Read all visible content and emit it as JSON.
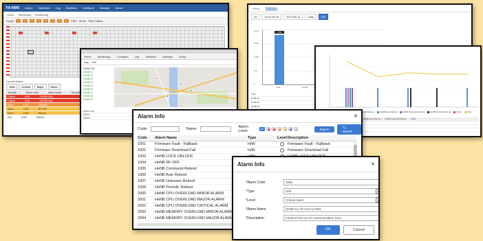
{
  "nms_window": {
    "logo": "FA-NMS",
    "menu": [
      "Admin",
      "Operation",
      "Log",
      "Statistics",
      "Configure",
      "Manage",
      "About"
    ],
    "breadcrumb": [
      "Home",
      "Monitoring",
      "Monitoring"
    ],
    "toolbar": [
      "Single",
      "Filter",
      "Mode",
      "Filter Status"
    ],
    "alarm_title": "Current Alarm",
    "alarm_tabs": [
      "Total",
      "Critical",
      "Major",
      "Minor"
    ],
    "alarm_header": [
      "Severity",
      "Alarm Code",
      "Alarm Name",
      "Occurred",
      "Occur Time"
    ],
    "alarm_rows": [
      {
        "severity": "Critical",
        "code": "2001",
        "name": "OVERLOAD",
        "level": "red"
      },
      {
        "severity": "Critical",
        "code": "2002",
        "name": "OVERLOAD",
        "level": "red"
      },
      {
        "severity": "Major",
        "code": "1001",
        "name": "Fallback",
        "level": "orange"
      },
      {
        "severity": "Minor",
        "code": "1004",
        "name": "RF OFF",
        "level": "yellow"
      },
      {
        "severity": "Minor",
        "code": "1005",
        "name": "Reboot",
        "level": "yellow"
      },
      {
        "severity": "Info",
        "code": "1006",
        "name": "Reboot",
        "level": "white"
      }
    ]
  },
  "map_window": {
    "nav": [
      "Home",
      "Monitoring",
      "Configure",
      "Log",
      "Statistics",
      "Manage",
      "Setup"
    ],
    "toolbar": [
      "Map",
      "Tree"
    ],
    "tree_items": [
      "HeNB-GW",
      "HeNB 01",
      "HeNB 02",
      "HeNB 03",
      "HeNB 04",
      "HeNB 05",
      "HeNB 06",
      "HeNB 07",
      "HeNB 08",
      "HeNB 09"
    ],
    "bottom_rows": [
      "Alarm List",
      "Event",
      "Status"
    ]
  },
  "stats_window": {
    "tabs": [
      "Home",
      "Statistics"
    ],
    "filters": [
      "All",
      "2013-08-08",
      "2013-08-15",
      "Daily"
    ],
    "ok_label": "OK",
    "bar_label": "1,750",
    "y_ticks": [
      "2000",
      "1500",
      "1000",
      "500",
      "0"
    ],
    "x_labels": [
      "Total",
      "HeNB"
    ],
    "table_rows": [
      "Total",
      "HeNB 01",
      "HeNB 02",
      "HeNB 03",
      "HeNB 04"
    ]
  },
  "line_window": {
    "legend": [
      {
        "name": "HeNB RF OFF",
        "color": "#5b8fd9"
      },
      {
        "name": "HeNB Command Reboot",
        "color": "#e06ab0"
      },
      {
        "name": "HeNB Auto Reboot",
        "color": "#3aa0a0"
      },
      {
        "name": "HeNB Unknown Reboot",
        "color": "#8a5ab8"
      },
      {
        "name": "HeNB Periodic Reboot",
        "color": "#333333"
      },
      {
        "name": "Other",
        "color": "#d84a3a"
      },
      {
        "name": "Total",
        "color": "#f0c040"
      }
    ],
    "table_header": [
      "HeNB RF OFF",
      "HeNB Command Reboot",
      "HeNB Auto Reboot",
      "HeNB Unknown Reboot",
      "Other"
    ]
  },
  "alarm_list": {
    "title": "Alarm Info",
    "code_label": "Code:",
    "name_label": "Name:",
    "level_label": "Alarm Level",
    "level_all": "All",
    "export_label": "Export",
    "search_label": "Search",
    "columns": [
      "Code",
      "Alarm Name",
      "Type",
      "Level",
      "Description"
    ],
    "rows": [
      {
        "code": "1001",
        "name": "Firmware Fault - Fallback",
        "type": "H/W",
        "desc": "Firmware Fault - Fallback"
      },
      {
        "code": "1002",
        "name": "Firmware Download Fail",
        "type": "H/W",
        "desc": "Firmware Download Fail"
      },
      {
        "code": "1003",
        "name": "HeNB LOCK UNLOCK",
        "type": "H/W",
        "desc": "HeNB LOCK UNLOCK"
      },
      {
        "code": "1004",
        "name": "HeNB RF OFF",
        "type": "H/W",
        "desc": "HeNB RF OFF"
      },
      {
        "code": "1005",
        "name": "HeNB Command Reboot",
        "type": "H/W",
        "desc": "HeNB Command Reboot"
      },
      {
        "code": "1006",
        "name": "HeNB Auto Reboot",
        "type": "H/W",
        "desc": "HeNB Auto Reboot"
      },
      {
        "code": "1007",
        "name": "HeNB Unknown Reboot",
        "type": "H/W",
        "desc": "HeNB Unknown Reboot"
      },
      {
        "code": "1008",
        "name": "HeNB Periodic Reboot",
        "type": "H/W",
        "desc": "HeNB Periodic Reboot"
      },
      {
        "code": "2000",
        "name": "HeNB CPU OVERLOAD MINOR ALARM",
        "type": "S/W",
        "desc": "HeNB CPU OVERLOAD MINOR"
      },
      {
        "code": "2001",
        "name": "HeNB CPU OVERLOAD MAJOR ALARM",
        "type": "S/W",
        "desc": "HeNB CPU OVERLOAD MAJOR"
      },
      {
        "code": "2002",
        "name": "HeNB CPU OVERLOAD CRITICAL ALARM",
        "type": "S/W",
        "desc": "HeNB CPU OVERLOAD CRITICAL"
      },
      {
        "code": "2003",
        "name": "HeNB MEMORY OVERLOAD MINOR ALARM",
        "type": "S/W",
        "desc": "HeNB MEMORY OVERLOAD MINOR"
      },
      {
        "code": "2004",
        "name": "HeNB MEMORY OVERLOAD MAJOR ALARM",
        "type": "S/W",
        "desc": "HeNB MEMORY OVERLOAD MAJOR"
      }
    ]
  },
  "alarm_form": {
    "title": "Alarm Info",
    "fields": [
      {
        "label": "*Alarm Code",
        "value": "3226",
        "dropdown": false
      },
      {
        "label": "*Type",
        "value": "S/W",
        "dropdown": true
      },
      {
        "label": "*Level",
        "value": "Critical Alarm",
        "dropdown": true
      },
      {
        "label": "*Alarm Name",
        "value": "HeNB S1-AP Fail ALARM",
        "dropdown": false
      },
      {
        "label": "*Description",
        "value": "Femto-FGW S1-AP communication error",
        "dropdown": false
      }
    ],
    "ok_label": "OK",
    "cancel_label": "Cancel"
  }
}
